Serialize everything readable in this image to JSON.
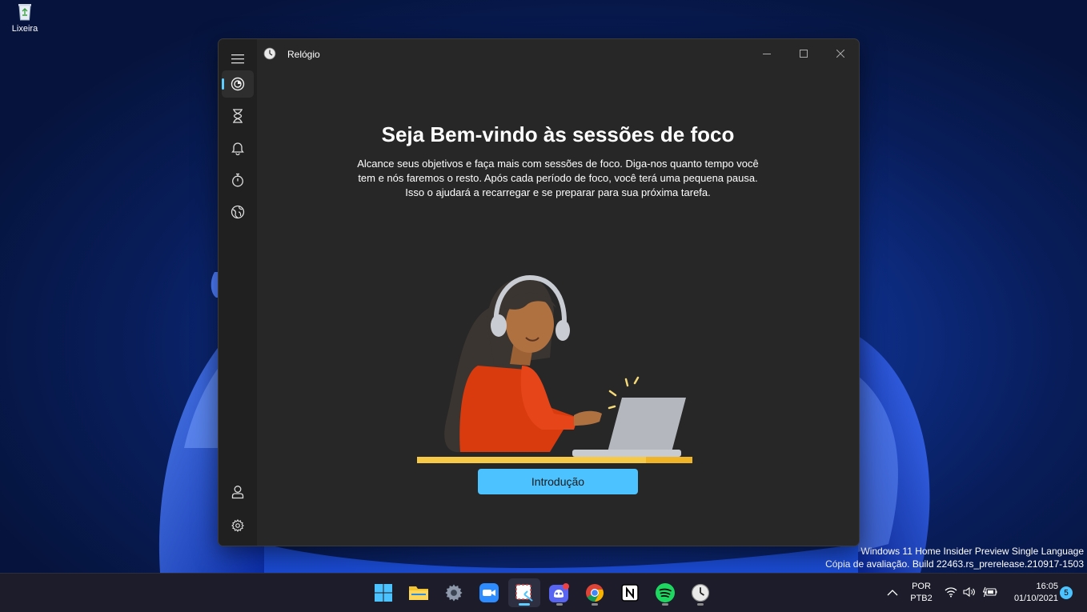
{
  "desktop": {
    "recycle_bin_label": "Lixeira",
    "watermark_line1": "Windows 11 Home Insider Preview Single Language",
    "watermark_line2": "Cópia de avaliação. Build 22463.rs_prerelease.210917-1503"
  },
  "window": {
    "title": "Relógio",
    "nav": [
      {
        "name": "focus-sessions",
        "icon": "focus-icon",
        "active": true
      },
      {
        "name": "timer",
        "icon": "hourglass-icon"
      },
      {
        "name": "alarm",
        "icon": "bell-icon"
      },
      {
        "name": "stopwatch",
        "icon": "stopwatch-icon"
      },
      {
        "name": "world-clock",
        "icon": "globe-icon"
      },
      {
        "name": "account",
        "icon": "person-icon"
      },
      {
        "name": "settings",
        "icon": "gear-icon"
      }
    ],
    "heading": "Seja Bem-vindo às sessões de foco",
    "description_line1": "Alcance seus objetivos e faça mais com sessões de foco. Diga-nos quanto tempo você",
    "description_line2": "tem e nós faremos o resto. Após cada período de foco, você terá uma pequena pausa.",
    "description_line3": "Isso o ajudará a recarregar e se preparar para sua próxima tarefa.",
    "cta_label": "Introdução",
    "accent_color": "#4cc2ff"
  },
  "taskbar": {
    "apps": [
      "windows-start",
      "file-explorer",
      "settings",
      "zoom",
      "snipping-tool",
      "discord",
      "chrome",
      "notion",
      "spotify",
      "clock"
    ],
    "language_line1": "POR",
    "language_line2": "PTB2",
    "time": "16:05",
    "date": "01/10/2021",
    "notification_count": "5"
  }
}
